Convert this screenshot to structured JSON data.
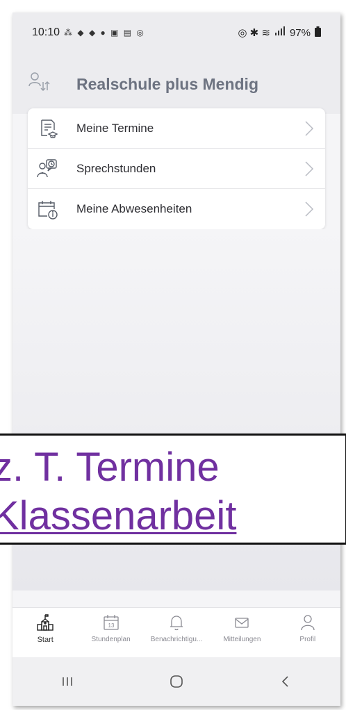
{
  "status_bar": {
    "time": "10:10",
    "left_icons": "⁂ ◆ ◆ ● ▣ ▤ ◎",
    "right_icons": "◎ ✱ ≋",
    "battery": "97%"
  },
  "header": {
    "title": "Realschule plus Mendig",
    "switch_icon": "user-switch-icon"
  },
  "menu": {
    "items": [
      {
        "label": "Meine Termine",
        "icon": "calendar-list-icon"
      },
      {
        "label": "Sprechstunden",
        "icon": "consultation-icon"
      },
      {
        "label": "Meine Abwesenheiten",
        "icon": "calendar-absence-icon"
      }
    ]
  },
  "overlay": {
    "line1": "z. T. Termine",
    "line2": "Klassenarbeit",
    "color": "#7030a0"
  },
  "bottom_nav": {
    "items": [
      {
        "label": "Start",
        "icon": "school-icon",
        "active": true
      },
      {
        "label": "Stundenplan",
        "icon": "calendar-13-icon",
        "day": "13"
      },
      {
        "label": "Benachrichtigu...",
        "icon": "bell-icon"
      },
      {
        "label": "Mitteilungen",
        "icon": "mail-icon"
      },
      {
        "label": "Profil",
        "icon": "person-icon"
      }
    ]
  },
  "system_nav": [
    "recent-apps-icon",
    "home-icon",
    "back-icon"
  ]
}
